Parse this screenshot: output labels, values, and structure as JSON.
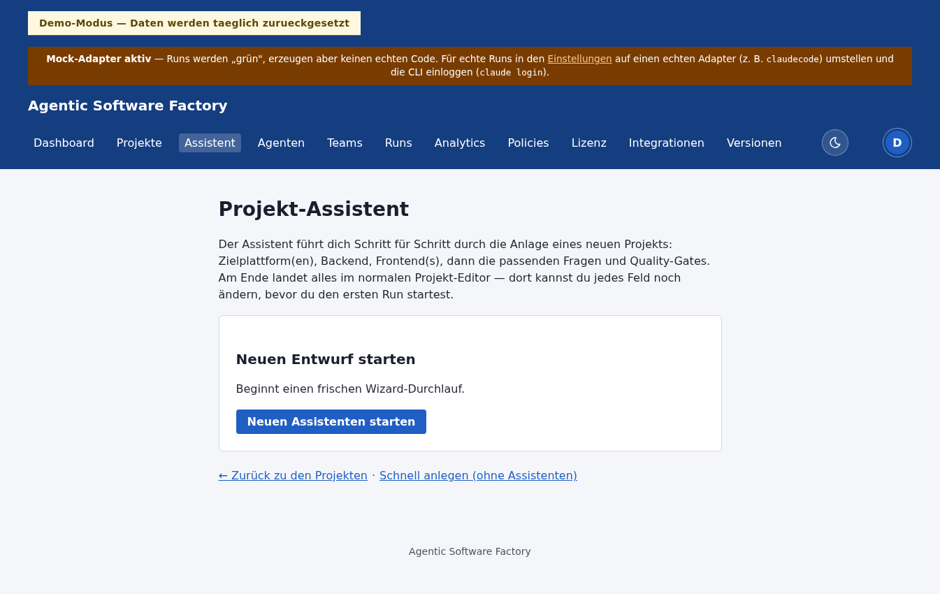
{
  "demo_banner": {
    "text": "Demo-Modus — Daten werden taeglich zurueckgesetzt"
  },
  "mock_notice": {
    "segments": [
      {
        "kind": "bold",
        "text": "Mock-Adapter aktiv"
      },
      {
        "kind": "text",
        "text": " — Runs werden „grün\", erzeugen aber keinen echten Code. Für echte Runs in den "
      },
      {
        "kind": "link",
        "text": "Einstellungen"
      },
      {
        "kind": "text",
        "text": " auf einen echten Adapter (z. B. "
      },
      {
        "kind": "code",
        "text": "claudecode"
      },
      {
        "kind": "text",
        "text": ") umstellen und die CLI einloggen ("
      },
      {
        "kind": "code",
        "text": "claude login"
      },
      {
        "kind": "text",
        "text": ")."
      }
    ]
  },
  "header": {
    "app_title": "Agentic Software Factory",
    "nav": [
      {
        "label": "Dashboard",
        "selected": false
      },
      {
        "label": "Projekte",
        "selected": false
      },
      {
        "label": "Assistent",
        "selected": true
      },
      {
        "label": "Agenten",
        "selected": false
      },
      {
        "label": "Teams",
        "selected": false
      },
      {
        "label": "Runs",
        "selected": false
      },
      {
        "label": "Analytics",
        "selected": false
      },
      {
        "label": "Policies",
        "selected": false
      },
      {
        "label": "Lizenz",
        "selected": false
      },
      {
        "label": "Integrationen",
        "selected": false
      },
      {
        "label": "Versionen",
        "selected": false
      }
    ],
    "avatar": {
      "initial": "D"
    }
  },
  "main": {
    "title": "Projekt-Assistent",
    "intro": "Der Assistent führt dich Schritt für Schritt durch die Anlage eines neuen Projekts: Zielplattform(en), Backend, Frontend(s), dann die passenden Fragen und Quality-Gates. Am Ende landet alles im normalen Projekt-Editor — dort kannst du jedes Feld noch ändern, bevor du den ersten Run startest.",
    "card": {
      "heading": "Neuen Entwurf starten",
      "text": "Beginnt einen frischen Wizard-Durchlauf.",
      "button": "Neuen Assistenten starten"
    },
    "links": [
      {
        "label": "← Zurück zu den Projekten"
      },
      {
        "label": "Schnell anlegen (ohne Assistenten)"
      }
    ],
    "link_separator": "·"
  },
  "footer": {
    "text": "Agentic Software Factory"
  }
}
